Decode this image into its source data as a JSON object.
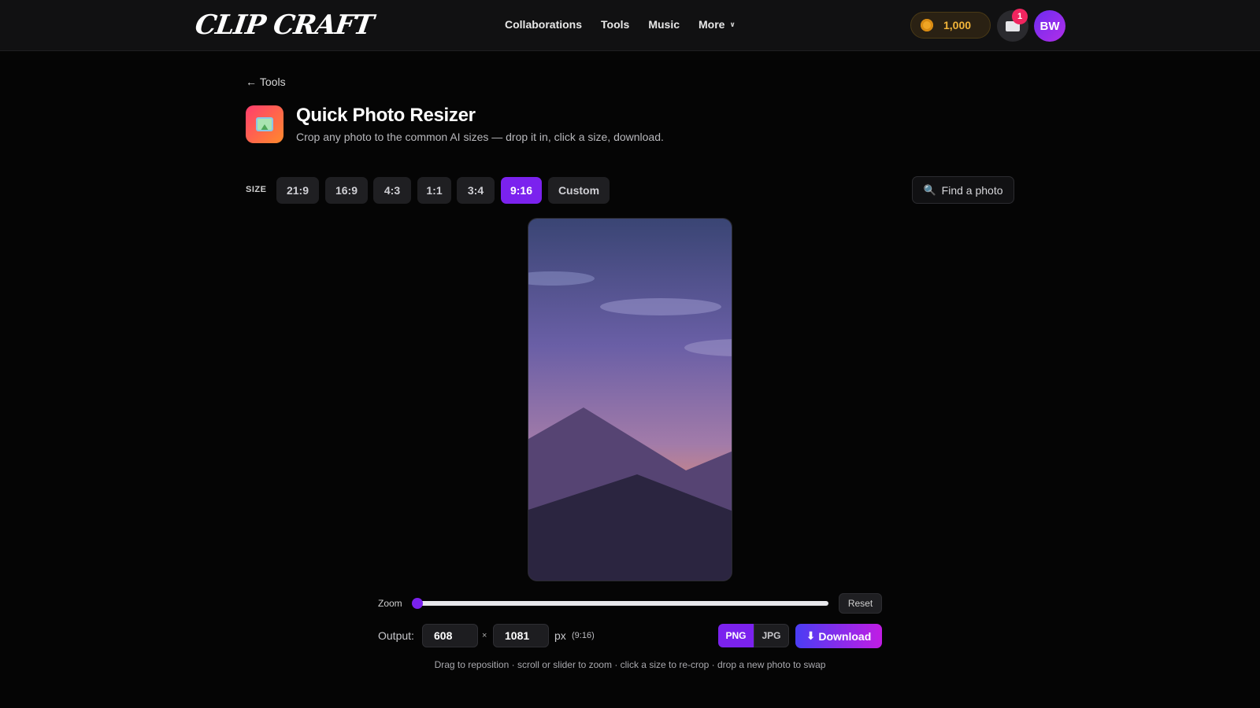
{
  "header": {
    "logo": "CLIP CRAFT",
    "nav": [
      "Collaborations",
      "Tools",
      "Music",
      "More"
    ],
    "coins": "1,000",
    "notifications": "1",
    "avatar": "BW"
  },
  "page": {
    "back_label": "Tools",
    "title": "Quick Photo Resizer",
    "subtitle": "Crop any photo to the common AI sizes — drop it in, click a size, download."
  },
  "size": {
    "label": "SIZE",
    "options": [
      "21:9",
      "16:9",
      "4:3",
      "1:1",
      "3:4",
      "9:16",
      "Custom"
    ],
    "selected": "9:16",
    "find_label": "Find a photo"
  },
  "zoom": {
    "label": "Zoom",
    "level": 0,
    "reset_label": "Reset"
  },
  "output": {
    "label": "Output:",
    "width": "608",
    "height": "1081",
    "times": "×",
    "unit": "px",
    "ratio": "(9:16)",
    "formats": [
      "PNG",
      "JPG"
    ],
    "selected_format": "PNG",
    "download_label": "Download"
  },
  "hint": "Drag to reposition · scroll or slider to zoom · click a size to re-crop · drop a new photo to swap",
  "colors": {
    "accent": "#7b22ee",
    "coin": "#f0a524",
    "badge": "#f0255f"
  }
}
